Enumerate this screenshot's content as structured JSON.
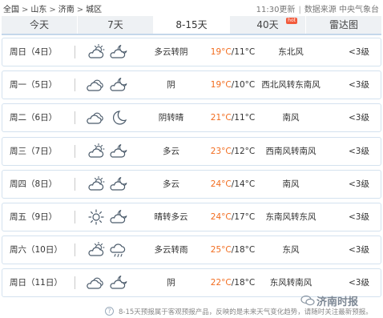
{
  "breadcrumb": [
    "全国",
    "山东",
    "济南",
    "城区"
  ],
  "breadcrumb_sep": ">",
  "meta": {
    "updated": "11:30更新",
    "source": "数据来源 中央气象台"
  },
  "tabs": [
    {
      "label": "今天",
      "active": false
    },
    {
      "label": "7天",
      "active": false
    },
    {
      "label": "8-15天",
      "active": true
    },
    {
      "label": "40天",
      "active": false,
      "badge": "hot"
    },
    {
      "label": "雷达图",
      "active": false
    }
  ],
  "forecast": [
    {
      "day": "周日（4日）",
      "icon_day": "cloudy-sun-icon",
      "icon_night": "cloudy-moon-icon",
      "desc": "多云转阴",
      "hi": "19°C",
      "lo": "11°C",
      "wind": "东北风",
      "level": "<3级"
    },
    {
      "day": "周一（5日）",
      "icon_day": "overcast-icon",
      "icon_night": "cloudy-moon-icon",
      "desc": "阴",
      "hi": "19°C",
      "lo": "10°C",
      "wind": "西北风转东南风",
      "level": "<3级"
    },
    {
      "day": "周二（6日）",
      "icon_day": "overcast-icon",
      "icon_night": "moon-icon",
      "desc": "阴转晴",
      "hi": "21°C",
      "lo": "11°C",
      "wind": "南风",
      "level": "<3级"
    },
    {
      "day": "周三（7日）",
      "icon_day": "cloudy-sun-icon",
      "icon_night": "cloudy-moon-icon",
      "desc": "多云",
      "hi": "23°C",
      "lo": "12°C",
      "wind": "西南风转南风",
      "level": "<3级"
    },
    {
      "day": "周四（8日）",
      "icon_day": "cloudy-sun-icon",
      "icon_night": "cloudy-moon-icon",
      "desc": "多云",
      "hi": "24°C",
      "lo": "14°C",
      "wind": "南风",
      "level": "<3级"
    },
    {
      "day": "周五（9日）",
      "icon_day": "sun-icon",
      "icon_night": "cloudy-moon-icon",
      "desc": "晴转多云",
      "hi": "24°C",
      "lo": "17°C",
      "wind": "东南风转东风",
      "level": "<3级"
    },
    {
      "day": "周六（10日）",
      "icon_day": "cloudy-sun-icon",
      "icon_night": "rain-cloud-icon",
      "desc": "多云转雨",
      "hi": "25°C",
      "lo": "18°C",
      "wind": "东风",
      "level": "<3级"
    },
    {
      "day": "周日（11日）",
      "icon_day": "overcast-icon",
      "icon_night": "cloudy-moon-icon",
      "desc": "阴",
      "hi": "22°C",
      "lo": "18°C",
      "wind": "东风转南风",
      "level": "<3级"
    }
  ],
  "temp_sep": "/",
  "footer_note": "8-15天预报属于客观预报产品，反映的是未来天气变化趋势，请随时关注最新预报。",
  "watermark": "济南时报",
  "colors": {
    "hi_temp": "#f26c1e",
    "row_border": "#d4e2ef",
    "tab_bg": "#eef1f4"
  }
}
